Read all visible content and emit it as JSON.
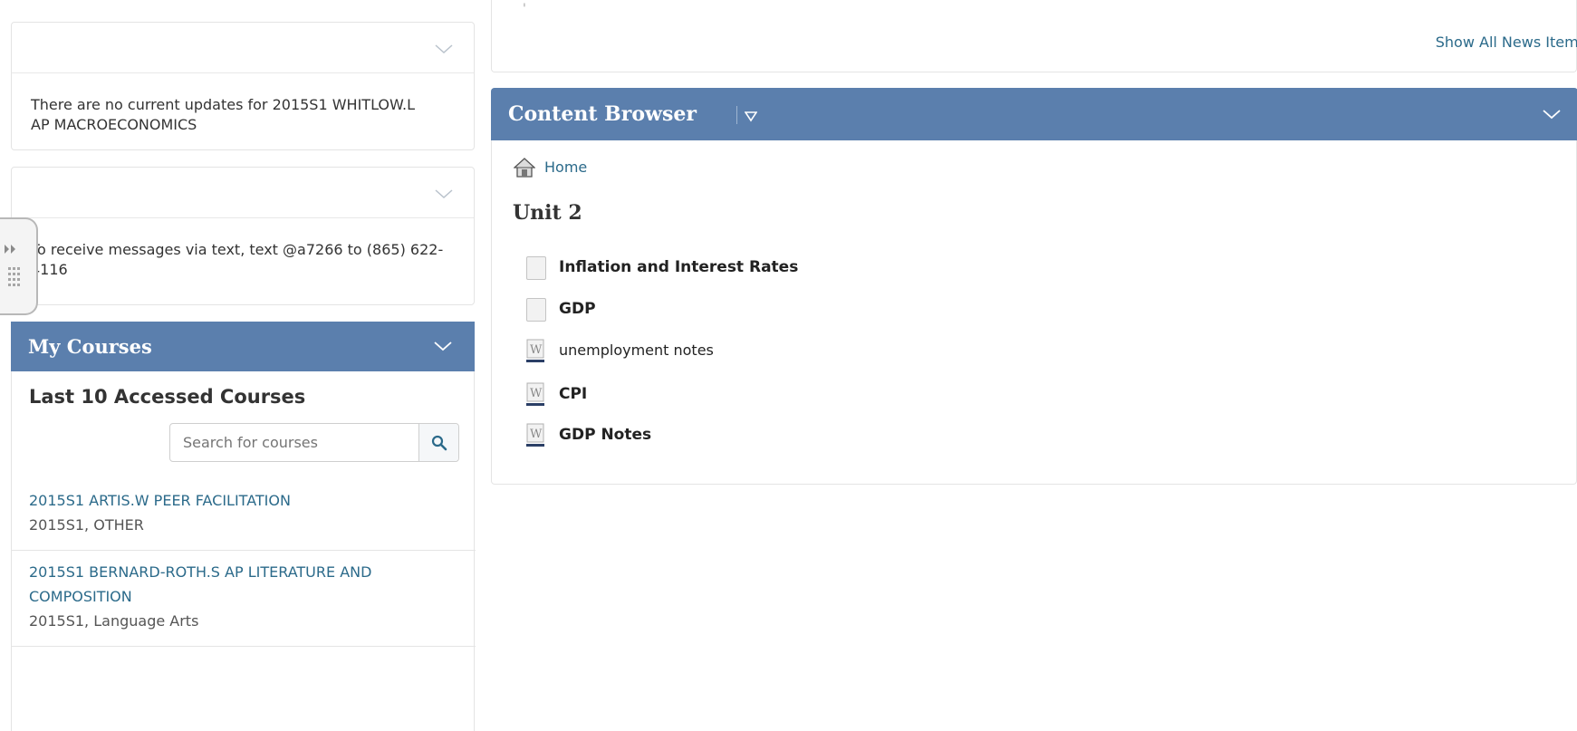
{
  "top_fragment": "'",
  "news": {
    "show_all_label": "Show All News Items"
  },
  "updates_widget": {
    "message": "There are no current updates for 2015S1 WHITLOW.L AP MACROECONOMICS"
  },
  "sms_widget": {
    "message": "To receive messages via text, text @a7266 to (865) 622-4116"
  },
  "my_courses": {
    "title": "My Courses",
    "subtitle": "Last 10 Accessed Courses",
    "search_placeholder": "Search for courses",
    "courses": [
      {
        "name": "2015S1 ARTIS.W PEER FACILITATION",
        "meta": "2015S1, OTHER"
      },
      {
        "name": "2015S1 BERNARD-ROTH.S AP LITERATURE AND COMPOSITION",
        "meta": "2015S1, Language Arts"
      }
    ]
  },
  "content_browser": {
    "title": "Content Browser",
    "breadcrumb_home": "Home",
    "unit_title": "Unit 2",
    "items": [
      {
        "label": "Inflation and Interest Rates",
        "icon": "blank-page-icon",
        "bold": true
      },
      {
        "label": "GDP",
        "icon": "blank-page-icon",
        "bold": true
      },
      {
        "label": "unemployment notes",
        "icon": "word-document-icon",
        "bold": false
      },
      {
        "label": "CPI",
        "icon": "word-document-icon",
        "bold": true
      },
      {
        "label": "GDP Notes",
        "icon": "word-document-icon",
        "bold": true
      }
    ]
  },
  "colors": {
    "header_blue": "#5b7fad",
    "link_blue": "#2b6a8a"
  }
}
